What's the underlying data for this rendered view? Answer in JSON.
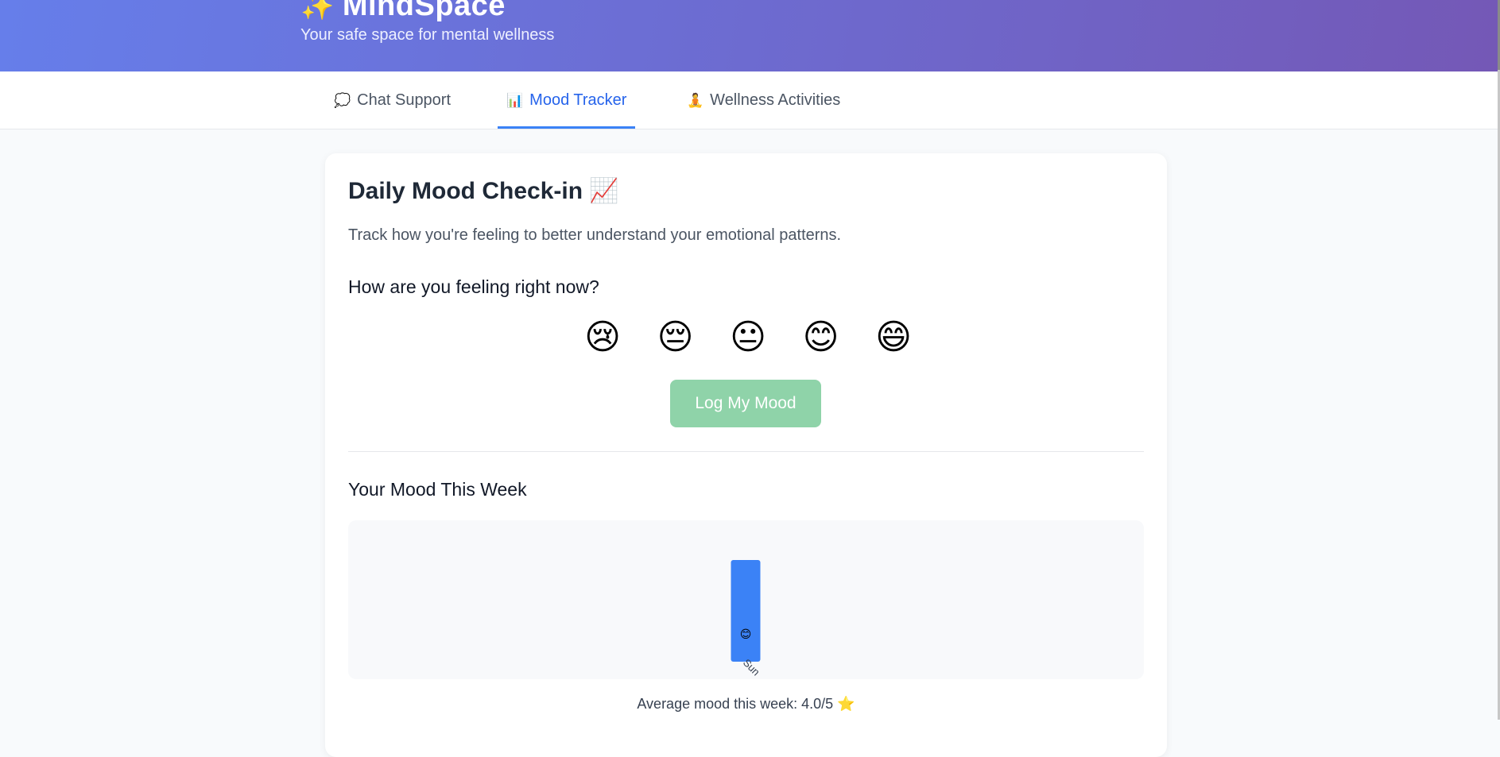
{
  "header": {
    "logo_icon": "✨",
    "title": "MindSpace",
    "subtitle": "Your safe space for mental wellness"
  },
  "tabs": [
    {
      "icon": "💭",
      "label": "Chat Support",
      "active": false
    },
    {
      "icon": "📊",
      "label": "Mood Tracker",
      "active": true
    },
    {
      "icon": "🧘",
      "label": "Wellness Activities",
      "active": false
    }
  ],
  "mood_card": {
    "title": "Daily Mood Check-in 📈",
    "description": "Track how you're feeling to better understand your emotional patterns.",
    "question": "How are you feeling right now?",
    "moods": [
      "😢",
      "😔",
      "😐",
      "😊",
      "😄"
    ],
    "log_button": "Log My Mood",
    "week_title": "Your Mood This Week",
    "average_text": "Average mood this week: 4.0/5 ⭐"
  },
  "chart_data": {
    "type": "bar",
    "categories": [
      "Sun"
    ],
    "values": [
      4
    ],
    "ylim": [
      0,
      5
    ],
    "bar_labels": [
      "😊"
    ],
    "bar_color": "#3b82f6"
  }
}
